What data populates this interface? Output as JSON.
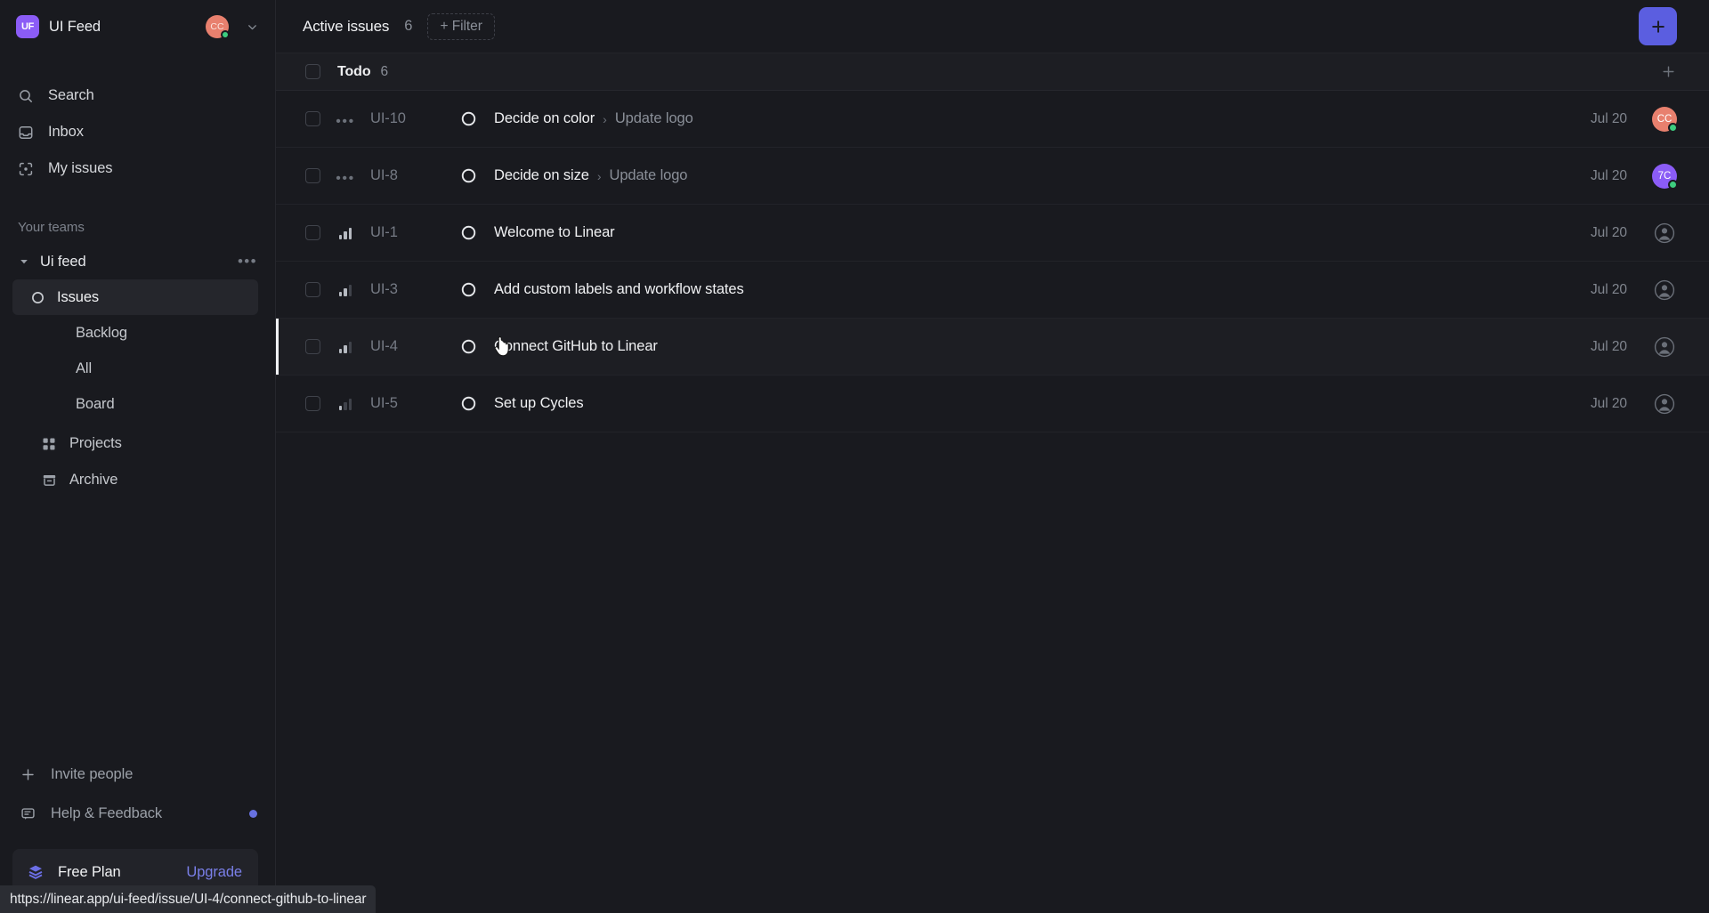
{
  "workspace": {
    "logo_text": "UF",
    "name": "UI Feed",
    "avatar_initials": "CC",
    "chevron_icon": "chevron-down-icon"
  },
  "sidebar": {
    "nav_top": [
      {
        "label": "Search",
        "icon": "search-icon"
      },
      {
        "label": "Inbox",
        "icon": "inbox-icon"
      },
      {
        "label": "My issues",
        "icon": "my-issues-icon"
      }
    ],
    "teams_section_label": "Your teams",
    "team": {
      "name": "Ui feed",
      "caret_icon": "caret-down-icon",
      "more_icon": "more-horizontal-icon",
      "children": [
        {
          "label": "Issues",
          "icon": "circle-icon",
          "active": true
        },
        {
          "label": "Backlog",
          "active": false
        },
        {
          "label": "All",
          "active": false
        },
        {
          "label": "Board",
          "active": false
        }
      ]
    },
    "mid_items": [
      {
        "label": "Projects",
        "icon": "grid-icon"
      },
      {
        "label": "Archive",
        "icon": "archive-icon"
      }
    ],
    "footer_items": [
      {
        "label": "Invite people",
        "icon": "plus-icon",
        "badge": false
      },
      {
        "label": "Help & Feedback",
        "icon": "message-icon",
        "badge": true
      }
    ],
    "plan": {
      "icon": "layers-icon",
      "name": "Free Plan",
      "upgrade_label": "Upgrade"
    }
  },
  "topbar": {
    "title": "Active issues",
    "count": "6",
    "filter_label": "+ Filter",
    "new_issue_icon": "plus-icon"
  },
  "group": {
    "title": "Todo",
    "count": "6",
    "add_icon": "plus-icon"
  },
  "issues": [
    {
      "id": "UI-10",
      "priority": "none",
      "status": "todo",
      "title": "Decide on color",
      "separator": "›",
      "parent": "Update logo",
      "date": "Jul 20",
      "assignee_initials": "CC",
      "assignee_color": "#e8806e",
      "assigned": true,
      "online": true,
      "hovered": false
    },
    {
      "id": "UI-8",
      "priority": "none",
      "status": "todo",
      "title": "Decide on size",
      "separator": "›",
      "parent": "Update logo",
      "date": "Jul 20",
      "assignee_initials": "7C",
      "assignee_color": "#8b5cf6",
      "assigned": true,
      "online": true,
      "hovered": false
    },
    {
      "id": "UI-1",
      "priority": "high",
      "status": "todo",
      "title": "Welcome to Linear",
      "separator": "",
      "parent": "",
      "date": "Jul 20",
      "assignee_initials": "",
      "assignee_color": "",
      "assigned": false,
      "online": false,
      "hovered": false
    },
    {
      "id": "UI-3",
      "priority": "medium",
      "status": "todo",
      "title": "Add custom labels and workflow states",
      "separator": "",
      "parent": "",
      "date": "Jul 20",
      "assignee_initials": "",
      "assignee_color": "",
      "assigned": false,
      "online": false,
      "hovered": false
    },
    {
      "id": "UI-4",
      "priority": "medium",
      "status": "todo",
      "title": "Connect GitHub to Linear",
      "separator": "",
      "parent": "",
      "date": "Jul 20",
      "assignee_initials": "",
      "assignee_color": "",
      "assigned": false,
      "online": false,
      "hovered": true
    },
    {
      "id": "UI-5",
      "priority": "low",
      "status": "todo",
      "title": "Set up Cycles",
      "separator": "",
      "parent": "",
      "date": "Jul 20",
      "assignee_initials": "",
      "assignee_color": "",
      "assigned": false,
      "online": false,
      "hovered": false
    }
  ],
  "statusbar": {
    "url": "https://linear.app/ui-feed/issue/UI-4/connect-github-to-linear"
  },
  "colors": {
    "accent": "#5b5ee0",
    "upgrade_link": "#7a7fe8",
    "background": "#191a1f",
    "row_hover": "#1d1e23",
    "online": "#3dcd7f"
  }
}
